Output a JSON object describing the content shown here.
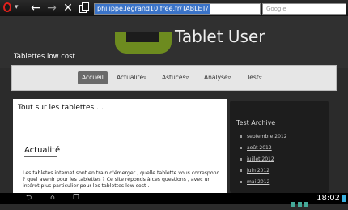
{
  "browser": {
    "url": "philippe.legrand10.free.fr/TABLET/",
    "search_placeholder": "Google"
  },
  "header": {
    "title": "Tablet User",
    "subtitle": "Tablettes low cost"
  },
  "nav": {
    "items": [
      {
        "label": "Accueil",
        "active": true
      },
      {
        "label": "Actualité",
        "active": false
      },
      {
        "label": "Astuces",
        "active": false
      },
      {
        "label": "Analyse",
        "active": false
      },
      {
        "label": "Test",
        "active": false
      }
    ]
  },
  "main": {
    "title": "Tout sur les tablettes …",
    "article_title": "Actualité",
    "article_text": "Les tabletes internet  sont en train d'émerger , quelle tablette vous correspond ? quel avenir pour les tablettes ?  Ce site réponds  à ces questions , avec un intéret plus  particulier pour  les tablettes low cost ."
  },
  "sidebar": {
    "title": "Test Archive",
    "archive": [
      "septembre 2012",
      "août 2012",
      "juillet 2012",
      "juin 2012",
      "mai 2012"
    ]
  },
  "system": {
    "clock": "18:02"
  },
  "colors": {
    "accent": "#3a73c8",
    "opera_red": "#e0201c",
    "android_green": "#6d8b1f"
  }
}
